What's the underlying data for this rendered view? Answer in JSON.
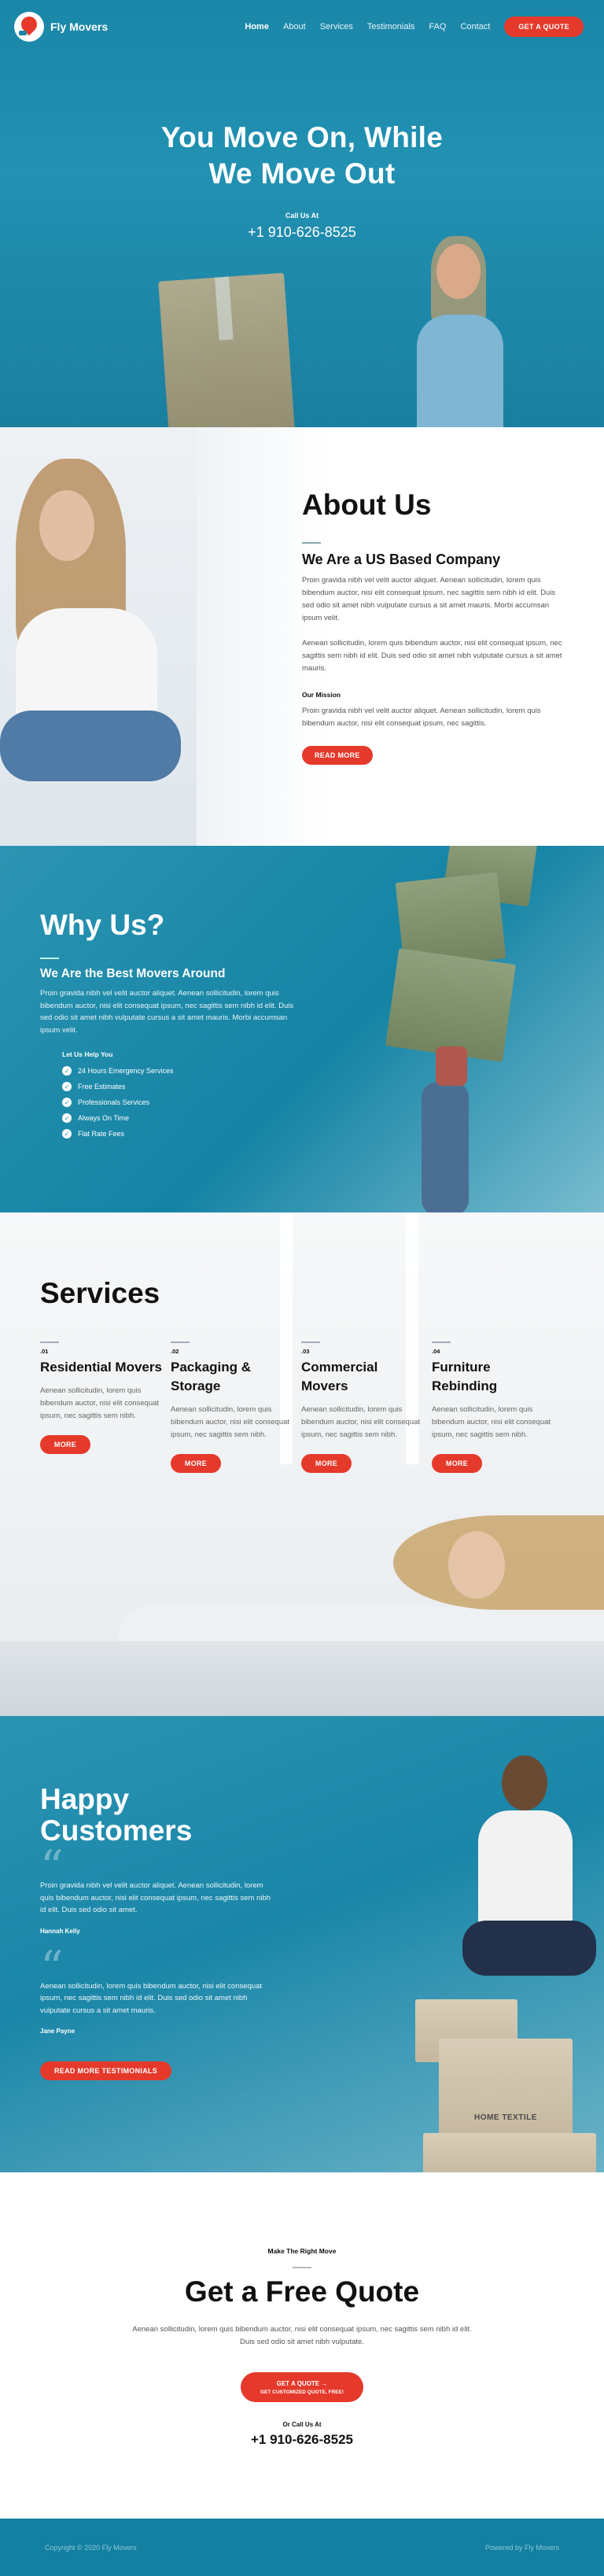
{
  "brand": {
    "name": "Fly Movers"
  },
  "nav": {
    "items": [
      "Home",
      "About",
      "Services",
      "Testimonials",
      "FAQ",
      "Contact"
    ],
    "cta": "GET A QUOTE"
  },
  "hero": {
    "title_line1": "You Move On, While",
    "title_line2": "We Move Out",
    "call_label": "Call Us At",
    "phone": "+1 910-626-8525"
  },
  "about": {
    "title": "About Us",
    "subtitle": "We Are a US Based Company",
    "p1": "Proin gravida nibh vel velit auctor aliquet. Aenean sollicitudin, lorem quis bibendum auctor, nisi elit consequat ipsum, nec sagittis sem nibh id elit. Duis sed odio sit amet nibh vulputate cursus a sit amet mauris. Morbi accumsan ipsum velit.",
    "p2": "Aenean sollicitudin, lorem quis bibendum auctor, nisi elit consequat ipsum, nec sagittis sem nibh id elit. Duis sed odio sit amet nibh vulputate cursus a sit amet mauris.",
    "mission_title": "Our Mission",
    "mission_text": "Proin gravida nibh vel velit auctor aliquet. Aenean sollicitudin, lorem quis bibendum auctor, nisi elit consequat ipsum, nec sagittis.",
    "button": "READ MORE"
  },
  "why": {
    "title": "Why Us?",
    "subtitle": "We Are the Best Movers Around",
    "text": "Proin gravida nibh vel velit auctor aliquet. Aenean sollicitudin, lorem quis bibendum auctor, nisi elit consequat ipsum, nec sagittis sem nibh id elit. Duis sed odio sit amet nibh vulputate cursus a sit amet mauris. Morbi accumsan ipsum velit.",
    "list_title": "Let Us Help You",
    "list": [
      "24 Hours Emergency Services",
      "Free Estimates",
      "Professionals Services",
      "Always On Time",
      "Flat Rate Fees"
    ]
  },
  "services": {
    "title": "Services",
    "items": [
      {
        "num": ".01",
        "title": "Residential Movers",
        "text": "Aenean sollicitudin, lorem quis bibendum auctor, nisi elit consequat ipsum, nec sagittis sem nibh.",
        "button": "MORE"
      },
      {
        "num": ".02",
        "title": "Packaging & Storage",
        "text": "Aenean sollicitudin, lorem quis bibendum auctor, nisi elit consequat ipsum, nec sagittis sem nibh.",
        "button": "MORE"
      },
      {
        "num": ".03",
        "title": "Commercial Movers",
        "text": "Aenean sollicitudin, lorem quis bibendum auctor, nisi elit consequat ipsum, nec sagittis sem nibh.",
        "button": "MORE"
      },
      {
        "num": ".04",
        "title": "Furniture Rebinding",
        "text": "Aenean sollicitudin, lorem quis bibendum auctor, nisi elit consequat ipsum, nec sagittis sem nibh.",
        "button": "MORE"
      }
    ]
  },
  "happy": {
    "title_line1": "Happy",
    "title_line2": "Customers",
    "quote1": "Proin gravida nibh vel velit auctor aliquet. Aenean sollicitudin, lorem quis bibendum auctor, nisi elit consequat ipsum, nec sagittis sem nibh id elit. Duis sed odio sit amet.",
    "author1": "Hannah Kelly",
    "quote2": "Aenean sollicitudin, lorem quis bibendum auctor, nisi elit consequat ipsum, nec sagittis sem nibh id elit. Duis sed odio sit amet nibh vulputate cursus a sit amet mauris.",
    "author2": "Jane Payne",
    "button": "READ MORE TESTIMONIALS",
    "crate_label": "HOME TEXTILE"
  },
  "quote": {
    "kicker": "Make The Right Move",
    "title": "Get a Free Quote",
    "text": "Aenean sollicitudin, lorem quis bibendum auctor, nisi elit consequat ipsum, nec sagittis sem nibh id elit. Duis sed odio sit amet nibh vulputate.",
    "cta_line1": "GET A QUOTE →",
    "cta_line2": "GET CUSTOMIZED QUOTE, FREE!",
    "call_label": "Or Call Us At",
    "phone": "+1 910-626-8525"
  },
  "footer": {
    "copyright": "Copyright © 2020 Fly Movers",
    "powered": "Powered by Fly Movers"
  },
  "colors": {
    "accent": "#e5392b",
    "primary": "#1a86a8",
    "footer": "#137fa1"
  }
}
